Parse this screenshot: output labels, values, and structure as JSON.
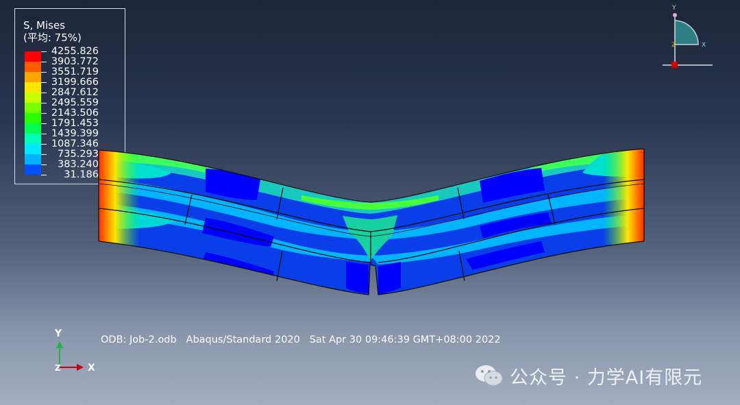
{
  "legend": {
    "title": "S, Mises",
    "subtitle": "(平均: 75%)",
    "values": [
      "4255.826",
      "3903.772",
      "3551.719",
      "3199.666",
      "2847.612",
      "2495.559",
      "2143.506",
      "1791.453",
      "1439.399",
      "1087.346",
      "735.293",
      "383.240",
      "31.186"
    ],
    "colors": [
      "#ff0000",
      "#ff5a00",
      "#ffa500",
      "#ffe600",
      "#c8ff00",
      "#78ff00",
      "#28ff00",
      "#00ff50",
      "#00ffb4",
      "#00eaff",
      "#00b4ff",
      "#0050ff",
      "#0000ff"
    ]
  },
  "footer": {
    "odb": "ODB: Job-2.odb",
    "solver": "Abaqus/Standard 2020",
    "date": "Sat Apr 30 09:46:39 GMT+08:00 2022"
  },
  "triad_main": {
    "y": "Y",
    "x": "X",
    "z": "Z"
  },
  "triad_view": {
    "y": "Y",
    "x": "X",
    "z": "Z"
  },
  "watermark": {
    "text": "公众号 · 力学AI有限元"
  }
}
